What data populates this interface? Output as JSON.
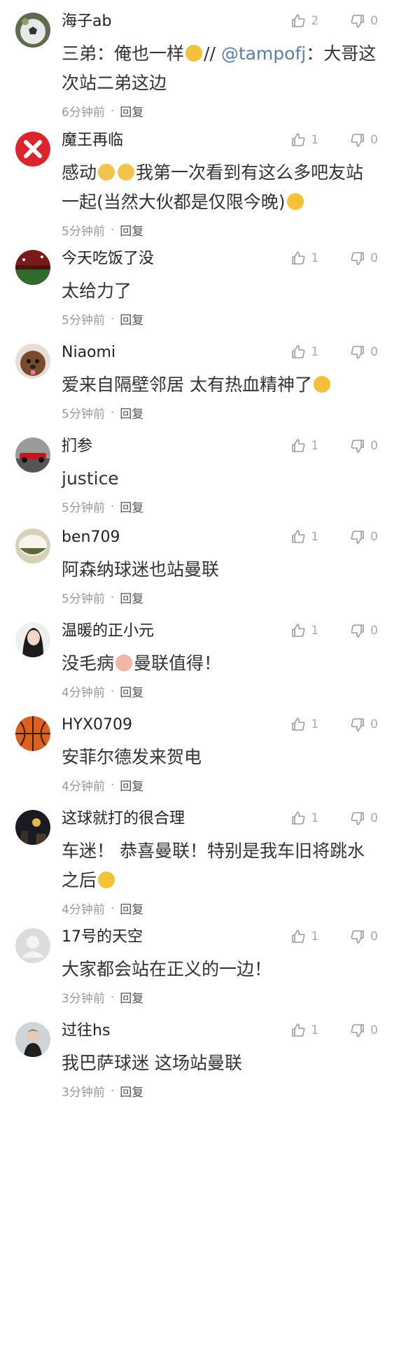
{
  "colors": {
    "accent": "#5b7fa6",
    "muted": "#999999",
    "text": "#333333"
  },
  "comments": [
    {
      "name": "海子ab",
      "pre": "三弟：俺也一样",
      "emoji": "grin",
      "mention_pre": "// ",
      "mention": "@tampofj",
      "post": "：大哥这次站二弟这边",
      "time": "6分钟前",
      "reply": "回复",
      "likes": "2",
      "dislikes": "0",
      "avatar": "soccer-ball",
      "height": 170
    },
    {
      "name": "魔王再临",
      "pre": "感动",
      "emoji2": [
        "cry-cat",
        "cry-cat"
      ],
      "post2": "我第一次看到有这么多吧友站一起(当然大伙都是仅限今晚)",
      "end_emoji": "grin",
      "time": "5分钟前",
      "reply": "回复",
      "likes": "1",
      "dislikes": "0",
      "avatar": "red-x",
      "height": 169
    },
    {
      "name": "今天吃饭了没",
      "text": "太给力了",
      "time": "5分钟前",
      "reply": "回复",
      "likes": "1",
      "dislikes": "0",
      "avatar": "stadium",
      "height": 134
    },
    {
      "name": "Niaomi",
      "text": "爱来自隔壁邻居 太有热血精神了",
      "end_emoji": "smirk",
      "time": "5分钟前",
      "reply": "回复",
      "likes": "1",
      "dislikes": "0",
      "avatar": "dog",
      "height": 134
    },
    {
      "name": "扪参",
      "text": "justice",
      "time": "5分钟前",
      "reply": "回复",
      "likes": "1",
      "dislikes": "0",
      "avatar": "f1-car",
      "height": 130
    },
    {
      "name": "ben709",
      "text": "阿森纳球迷也站曼联",
      "time": "5分钟前",
      "reply": "回复",
      "likes": "1",
      "dislikes": "0",
      "avatar": "food-bowl",
      "height": 134
    },
    {
      "name": "温暖的正小元",
      "text": "没毛病",
      "mid_emoji": "hands",
      "post3": "曼联值得！",
      "time": "4分钟前",
      "reply": "回复",
      "likes": "1",
      "dislikes": "0",
      "avatar": "girl",
      "height": 134
    },
    {
      "name": "HYX0709",
      "text": "安菲尔德发来贺电",
      "time": "4分钟前",
      "reply": "回复",
      "likes": "1",
      "dislikes": "0",
      "avatar": "basketball",
      "height": 134
    },
    {
      "name": "这球就打的很合理",
      "text": "车迷！ 恭喜曼联！特别是我车旧将跳水之后",
      "end_emoji": "sweat",
      "time": "4分钟前",
      "reply": "回复",
      "likes": "1",
      "dislikes": "0",
      "avatar": "night",
      "height": 169
    },
    {
      "name": "17号的天空",
      "text": "大家都会站在正义的一边！",
      "time": "3分钟前",
      "reply": "回复",
      "likes": "1",
      "dislikes": "0",
      "avatar": "default",
      "height": 134
    },
    {
      "name": "过往hs",
      "text": "我巴萨球迷 这场站曼联",
      "time": "3分钟前",
      "reply": "回复",
      "likes": "1",
      "dislikes": "0",
      "avatar": "man",
      "height": 150
    }
  ]
}
